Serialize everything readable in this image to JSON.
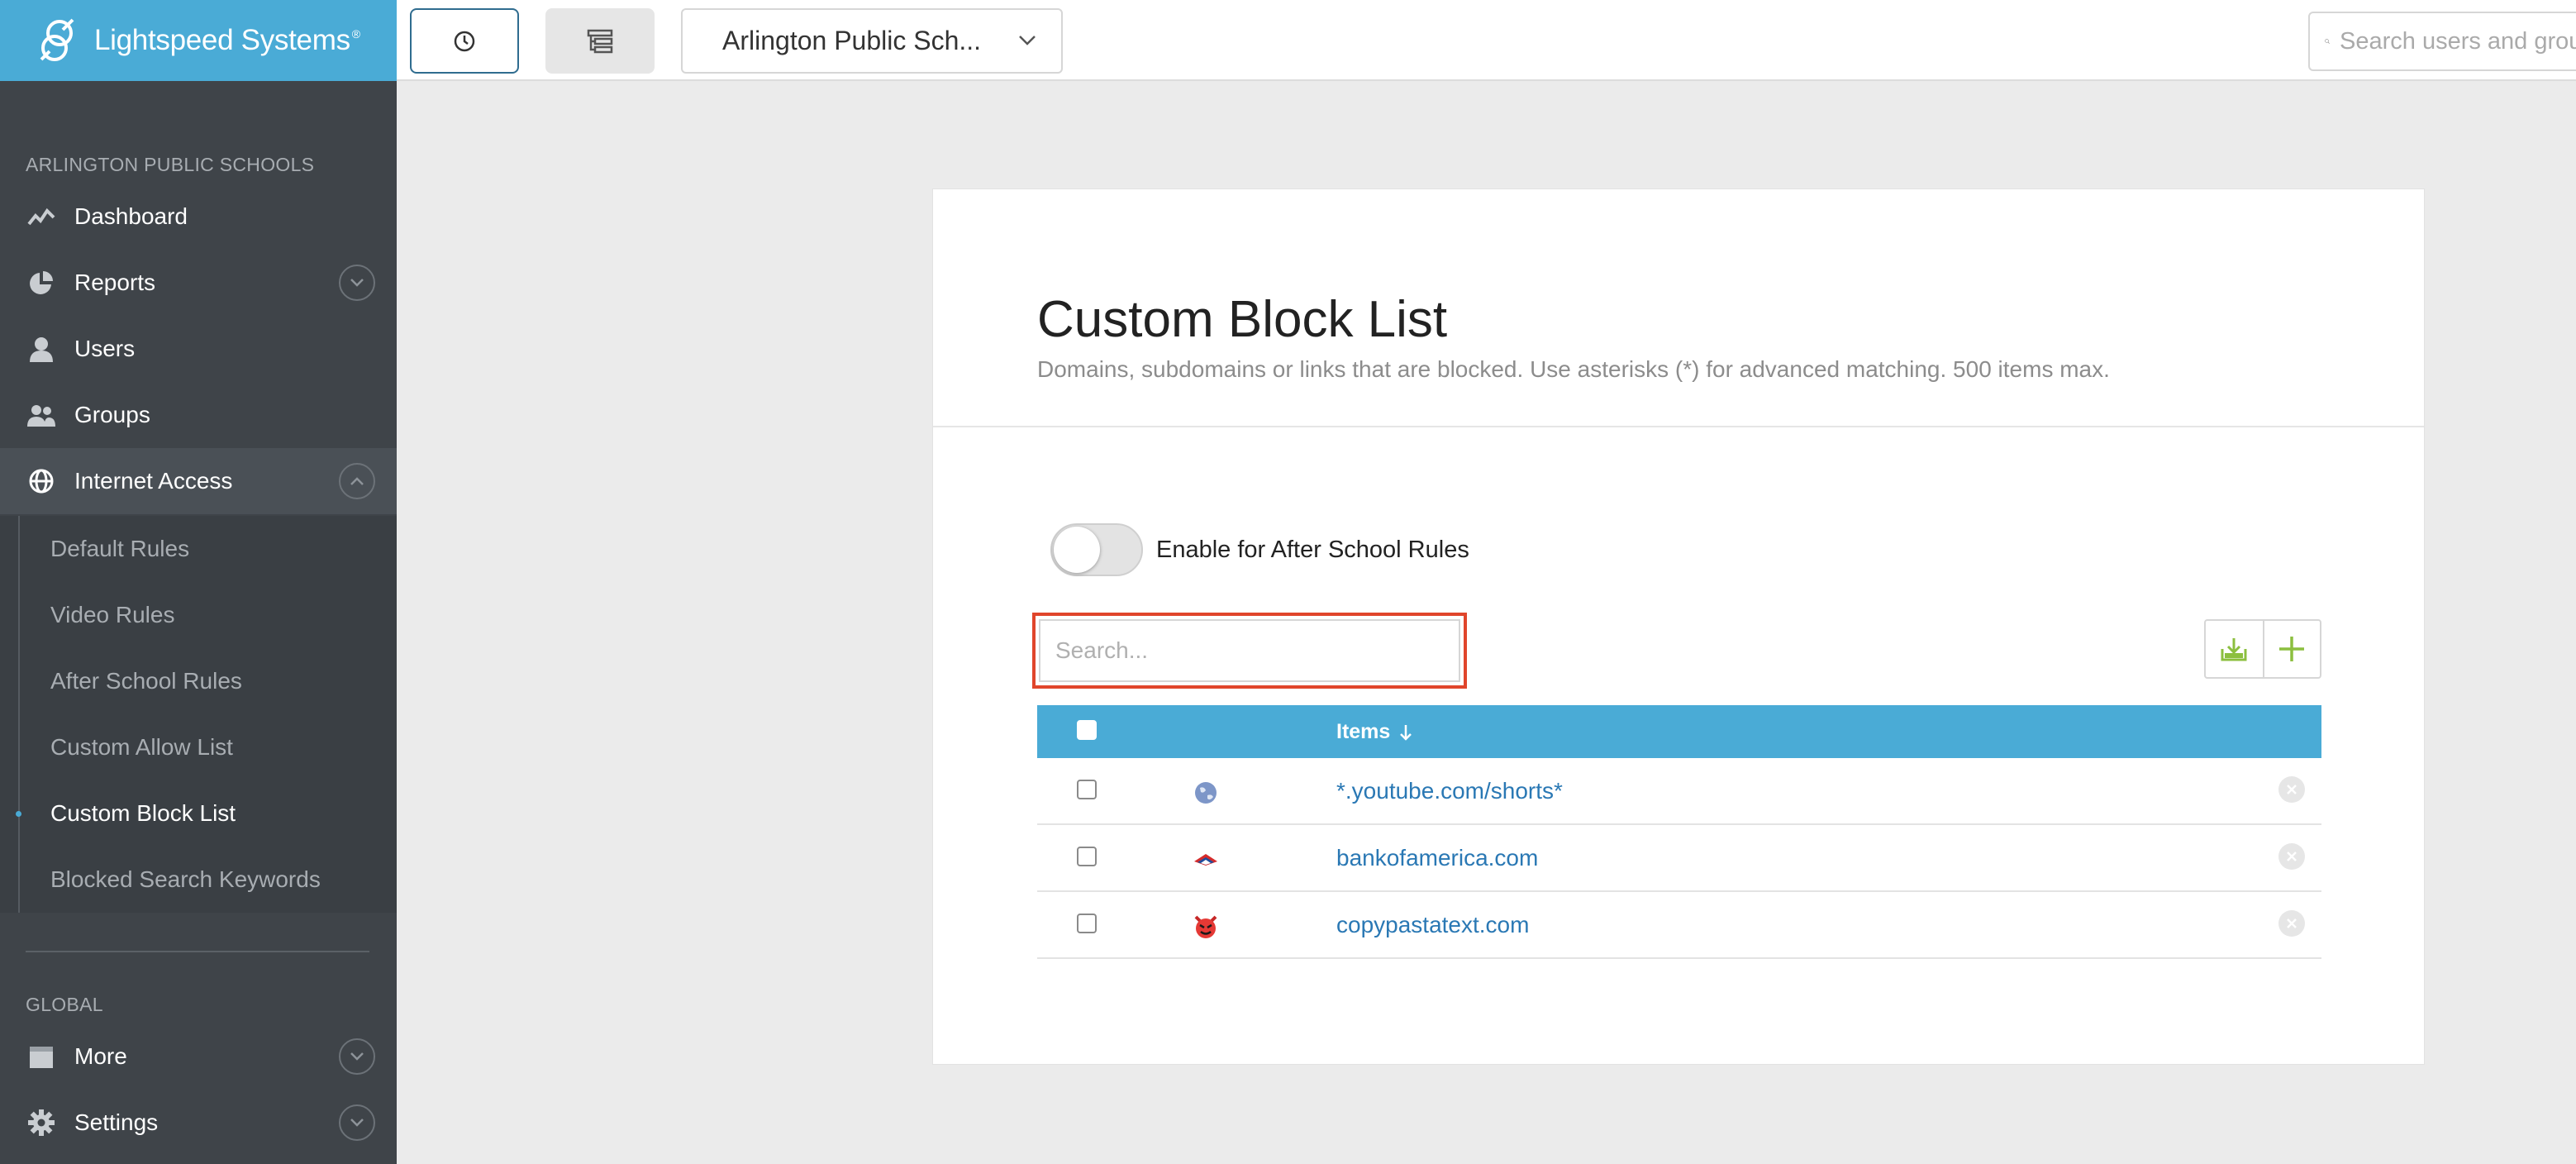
{
  "brand": {
    "name": "Lightspeed Systems",
    "mark": "®"
  },
  "sidebar": {
    "org_label": "ARLINGTON PUBLIC SCHOOLS",
    "items": [
      {
        "label": "Dashboard",
        "icon": "activity-icon"
      },
      {
        "label": "Reports",
        "icon": "pie-chart-icon"
      },
      {
        "label": "Users",
        "icon": "user-icon"
      },
      {
        "label": "Groups",
        "icon": "users-icon"
      },
      {
        "label": "Internet Access",
        "icon": "globe-icon"
      }
    ],
    "sub_items": [
      {
        "label": "Default Rules"
      },
      {
        "label": "Video Rules"
      },
      {
        "label": "After School Rules"
      },
      {
        "label": "Custom Allow List"
      },
      {
        "label": "Custom Block List"
      },
      {
        "label": "Blocked Search Keywords"
      }
    ],
    "global_label": "GLOBAL",
    "global_items": [
      {
        "label": "More",
        "icon": "calendar-icon"
      },
      {
        "label": "Settings",
        "icon": "gear-icon"
      }
    ]
  },
  "topbar": {
    "org_select": "Arlington Public Sch...",
    "search_placeholder": "Search users and groups"
  },
  "page": {
    "title": "Custom Block List",
    "subtitle": "Domains, subdomains or links that are blocked. Use asterisks (*) for advanced matching. 500 items max.",
    "toggle_label": "Enable for After School Rules",
    "search_placeholder": "Search...",
    "table": {
      "header": "Items",
      "rows": [
        {
          "item": "*.youtube.com/shorts*",
          "favicon": "globe-favicon"
        },
        {
          "item": "bankofamerica.com",
          "favicon": "bank-favicon"
        },
        {
          "item": "copypastatext.com",
          "favicon": "devil-favicon"
        }
      ]
    }
  },
  "colors": {
    "accent": "#4aabd6",
    "sidebar": "#3f4449",
    "link": "#2a78b4",
    "add_green": "#8cbf3f",
    "highlight": "#e0452b"
  }
}
